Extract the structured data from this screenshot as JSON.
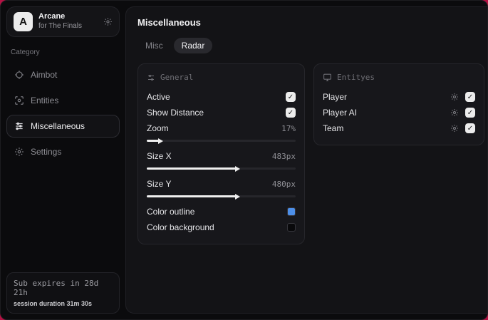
{
  "sidebar": {
    "app": {
      "initial": "A",
      "name": "Arcane",
      "subtitle": "for The Finals"
    },
    "category_label": "Category",
    "items": [
      {
        "label": "Aimbot",
        "active": false
      },
      {
        "label": "Entities",
        "active": false
      },
      {
        "label": "Miscellaneous",
        "active": true
      },
      {
        "label": "Settings",
        "active": false
      }
    ],
    "footer": {
      "line1": "Sub expires in 28d 21h",
      "line2": "session duration 31m 30s"
    }
  },
  "main": {
    "title": "Miscellaneous",
    "tabs": [
      {
        "label": "Misc",
        "active": false
      },
      {
        "label": "Radar",
        "active": true
      }
    ],
    "general": {
      "title": "General",
      "toggles": [
        {
          "label": "Active",
          "checked": true
        },
        {
          "label": "Show Distance",
          "checked": true
        }
      ],
      "sliders": [
        {
          "label": "Zoom",
          "value": "17%",
          "percent": 8
        },
        {
          "label": "Size X",
          "value": "483px",
          "percent": 60
        },
        {
          "label": "Size Y",
          "value": "480px",
          "percent": 60
        }
      ],
      "colors": [
        {
          "label": "Color outline",
          "color": "#4d8fe8"
        },
        {
          "label": "Color background",
          "color": "#09090b"
        }
      ]
    },
    "entities": {
      "title": "Entityes",
      "rows": [
        {
          "label": "Player",
          "checked": true
        },
        {
          "label": "Player AI",
          "checked": true
        },
        {
          "label": "Team",
          "checked": true
        }
      ]
    }
  },
  "glyphs": {
    "check": "✓"
  },
  "colors": {
    "backdrop": "#b31243",
    "accent_blue": "#4d8fe8",
    "swatch_black": "#09090b"
  }
}
